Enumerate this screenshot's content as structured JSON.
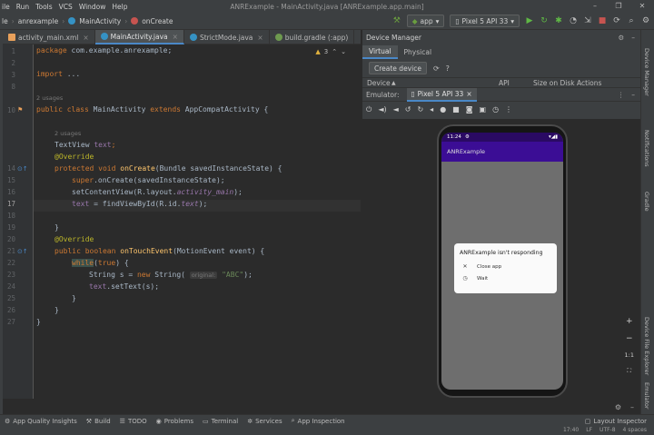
{
  "window": {
    "title": "ANRExample - MainActivity.java [ANRExample.app.main]",
    "menu": [
      "ile",
      "Run",
      "Tools",
      "VCS",
      "Window",
      "Help"
    ]
  },
  "breadcrumb": {
    "items": [
      "le",
      "anrexample",
      "MainActivity",
      "onCreate"
    ]
  },
  "toolbar": {
    "run_config": "app",
    "device": "Pixel 5 API 33"
  },
  "editor_tabs": [
    {
      "label": "activity_main.xml",
      "icon": "xml-file-icon"
    },
    {
      "label": "MainActivity.java",
      "icon": "java-class-icon"
    },
    {
      "label": "StrictMode.java",
      "icon": "java-class-icon"
    },
    {
      "label": "build.gradle (:app)",
      "icon": "gradle-icon"
    }
  ],
  "editor": {
    "warnings_count": "3",
    "line_numbers": [
      "1",
      "2",
      "3",
      "8",
      "",
      "10",
      "",
      "",
      "",
      "14",
      "15",
      "16",
      "17",
      "18",
      "19",
      "20",
      "21",
      "22",
      "23",
      "24",
      "25",
      "26",
      "27"
    ],
    "hints": {
      "usages_1": "2 usages",
      "usages_2": "2 usages"
    },
    "code": {
      "l1_kw": "package",
      "l1_rest": " com.example.anrexample;",
      "l3_kw": "import",
      "l3_rest": " ...",
      "l10_kw1": "public class",
      "l10_name": " MainActivity ",
      "l10_kw2": "extends",
      "l10_rest": " AppCompatActivity {",
      "l12_type": "TextView ",
      "l12_field": "text",
      "l12_end": ";",
      "l13_ann": "@Override",
      "l14_kw": "protected void",
      "l14_fn": " onCreate",
      "l14_rest": "(Bundle savedInstanceState) {",
      "l15_kw": "super",
      "l15_rest": ".onCreate(savedInstanceState);",
      "l16_a": "setContentView(R.layout.",
      "l16_it": "activity_main",
      "l16_b": ");",
      "l17_field": "text",
      "l17_a": " = findViewById(R.id.",
      "l17_it": "text",
      "l17_b": ");",
      "l19_close": "}",
      "l20_ann": "@Override",
      "l21_kw": "public boolean",
      "l21_fn": " onTouchEvent",
      "l21_rest": "(MotionEvent event) {",
      "l22_kw": "while",
      "l22_a": "(",
      "l22_kw2": "true",
      "l22_b": ") {",
      "l23_a": "String s = ",
      "l23_kw": "new",
      "l23_b": " String( ",
      "l23_hint": "original:",
      "l23_str": " \"ABC\"",
      "l23_c": ");",
      "l24_field": "text",
      "l24_rest": ".setText(s);",
      "l25_close": "}",
      "l26_close": "}",
      "l27_close": "}"
    }
  },
  "device_manager": {
    "title": "Device Manager",
    "tabs": [
      "Virtual",
      "Physical"
    ],
    "create_button": "Create device",
    "columns": [
      "Device",
      "API",
      "Size on Disk",
      "Actions"
    ],
    "emulator_label": "Emulator:",
    "emulator_tab": "Pixel 5 API 33"
  },
  "phone": {
    "time": "11:24",
    "app_title": "ANRExample",
    "dialog_title": "ANRExample isn't responding",
    "options": [
      "Close app",
      "Wait"
    ],
    "zoom_label": "1:1"
  },
  "right_strip": [
    "Device Manager",
    "Notifications",
    "Gradle",
    "Device File Explorer",
    "Emulator"
  ],
  "bottom_tools": [
    "App Quality Insights",
    "Build",
    "TODO",
    "Problems",
    "Terminal",
    "Services",
    "App Inspection"
  ],
  "bottom_right": "Layout Inspector",
  "status": {
    "pos": "17:40",
    "lf": "LF",
    "enc": "UTF-8",
    "indent": "4 spaces"
  },
  "colors": {
    "keyword": "#cc7832",
    "annotation": "#bbb529",
    "method": "#ffc66d",
    "field": "#9876aa",
    "string": "#6a8759",
    "app_bar": "#3b0d95"
  }
}
